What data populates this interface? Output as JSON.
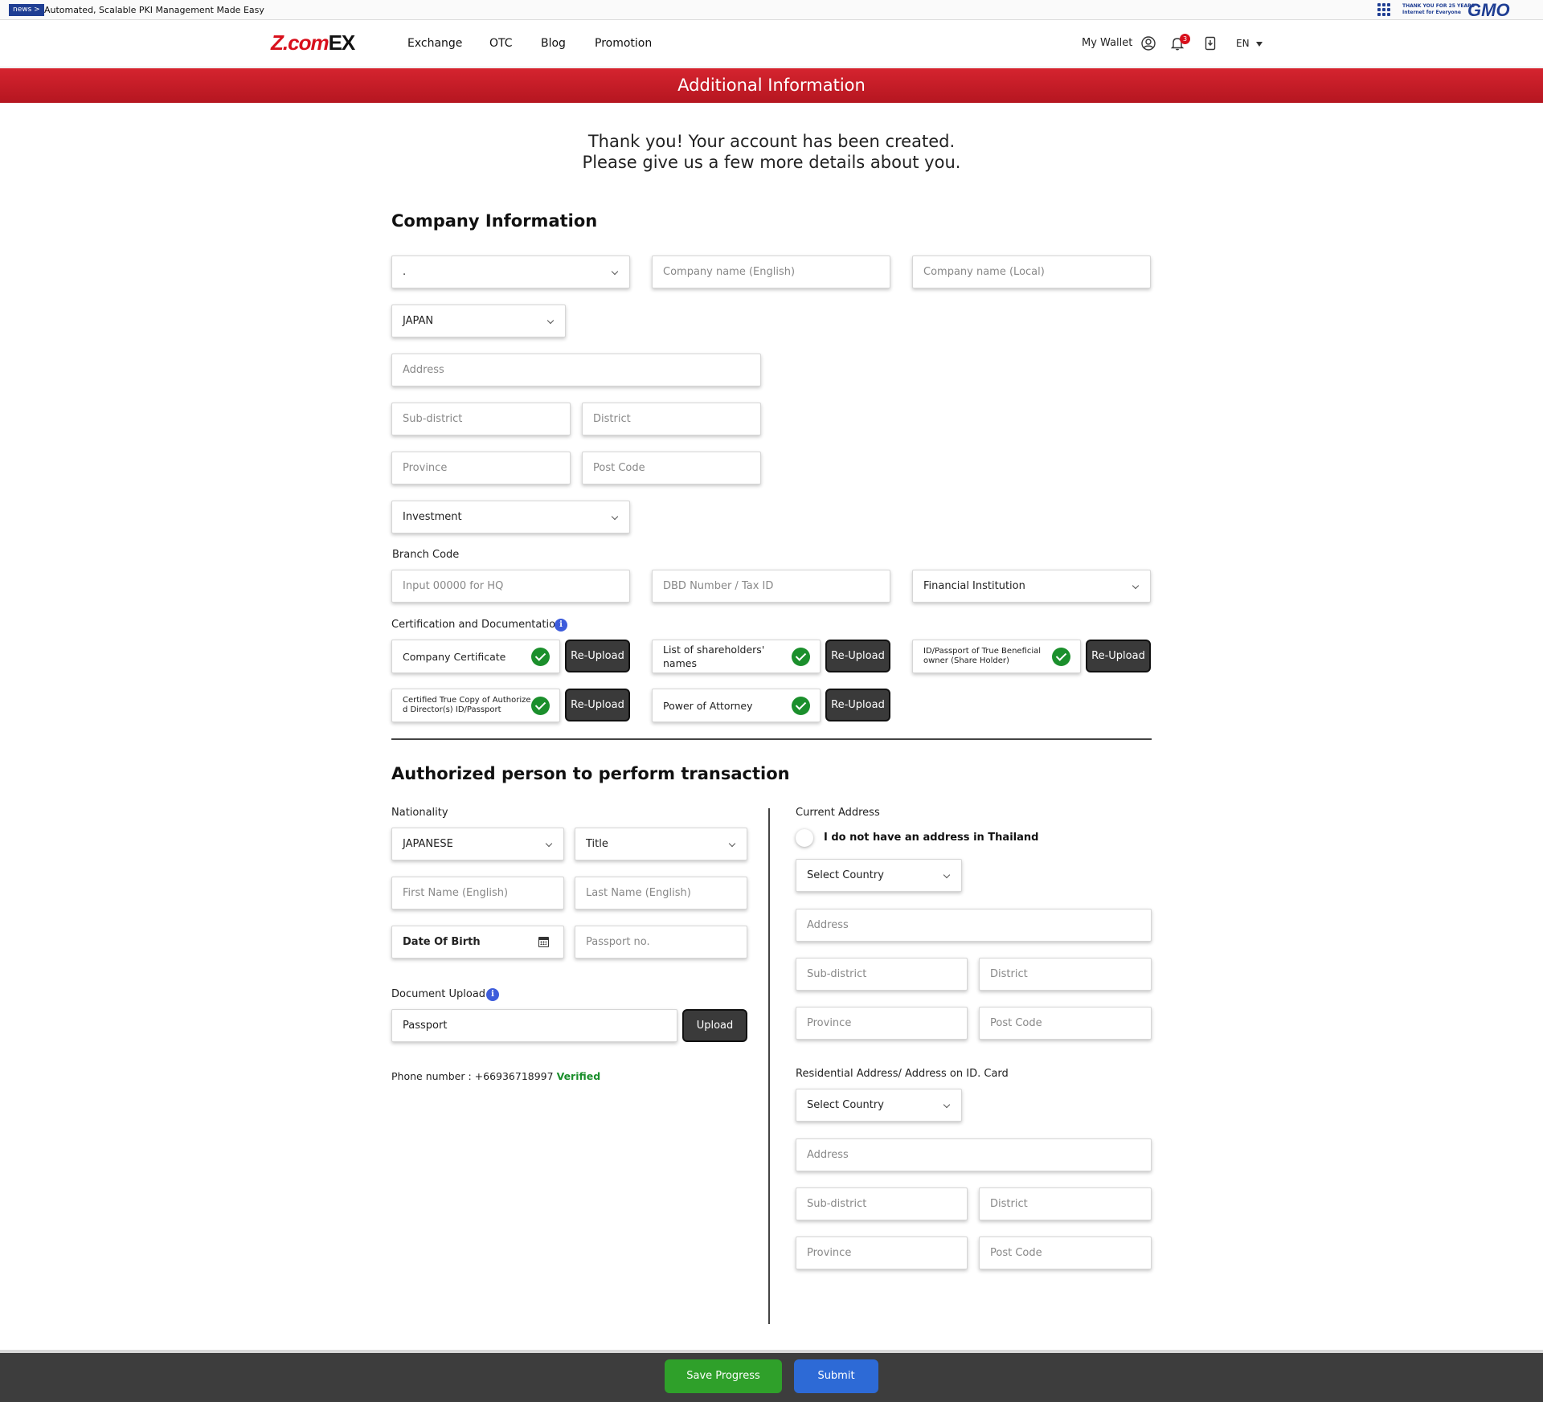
{
  "newsbar": {
    "tag": "news >",
    "text": "Automated, Scalable PKI Management Made Easy",
    "brand_tagline_1": "THANK YOU FOR 25 YEARS",
    "brand_tagline_2": "Internet for Everyone",
    "brand": "GMO"
  },
  "header": {
    "logo": "Z.com",
    "logo_suffix": "EX",
    "nav": [
      "Exchange",
      "OTC",
      "Blog",
      "Promotion"
    ],
    "wallet": "My Wallet",
    "notification_count": "3",
    "language": "EN"
  },
  "banner": {
    "title": "Additional Information"
  },
  "intro": {
    "line1": "Thank you! Your account has been created.",
    "line2": "Please give us a few more details about you."
  },
  "company": {
    "title": "Company Information",
    "prefix_value": ".",
    "name_en_ph": "Company name (English)",
    "name_local_ph": "Company name (Local)",
    "country": "JAPAN",
    "address_ph": "Address",
    "subdistrict_ph": "Sub-district",
    "district_ph": "District",
    "province_ph": "Province",
    "postcode_ph": "Post Code",
    "business_type": "Investment",
    "branch_label": "Branch Code",
    "branch_ph": "Input 00000 for HQ",
    "tax_ph": "DBD Number / Tax ID",
    "institution": "Financial Institution",
    "cert_label": "Certification and Documentation",
    "docs": {
      "company_cert": "Company Certificate",
      "shareholders": "List of shareholders' names",
      "beneficial": "ID/Passport of True Beneficial owner (Share Holder)",
      "directors": "Certified True Copy of Authorized Director(s) ID/Passport",
      "poa": "Power of Attorney"
    },
    "reupload": "Re-Upload"
  },
  "person": {
    "title": "Authorized person to perform transaction",
    "nationality_label": "Nationality",
    "nationality": "JAPANESE",
    "title_select": "Title",
    "first_ph": "First Name (English)",
    "last_ph": "Last Name (English)",
    "dob": "Date Of Birth",
    "passport_ph": "Passport no.",
    "doc_upload_label": "Document Upload",
    "doc_type": "Passport",
    "upload_btn": "Upload",
    "phone_label": "Phone number : +66936718997",
    "phone_status": "Verified"
  },
  "current_address": {
    "label": "Current Address",
    "toggle_label": "I do not have an address in Thailand",
    "country_ph": "Select Country",
    "address_ph": "Address",
    "subdistrict_ph": "Sub-district",
    "district_ph": "District",
    "province_ph": "Province",
    "postcode_ph": "Post Code"
  },
  "residential_address": {
    "label": "Residential Address/ Address on ID. Card",
    "country_ph": "Select Country",
    "address_ph": "Address",
    "subdistrict_ph": "Sub-district",
    "district_ph": "District",
    "province_ph": "Province",
    "postcode_ph": "Post Code"
  },
  "footer": {
    "save": "Save Progress",
    "submit": "Submit"
  },
  "colors": {
    "banner": "#c41c26",
    "save": "#2fa02a",
    "submit": "#2d6ad6",
    "verified": "#1b8f2c"
  }
}
